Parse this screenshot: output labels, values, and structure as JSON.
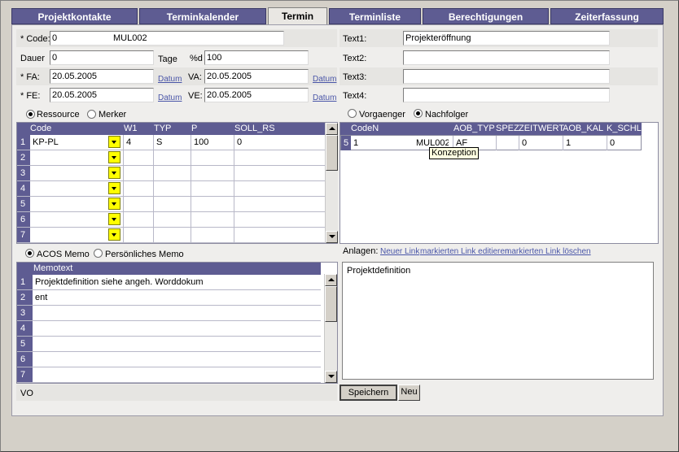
{
  "tabs": [
    {
      "label": "Projektkontakte"
    },
    {
      "label": "Terminkalender"
    },
    {
      "label": "Termin"
    },
    {
      "label": "Terminliste"
    },
    {
      "label": "Berechtigungen"
    },
    {
      "label": "Zeiterfassung"
    }
  ],
  "form": {
    "code_label": "* Code:",
    "code_value": "0",
    "code_id": "MUL002",
    "dauer_label": "Dauer",
    "dauer_value": "0",
    "tage_label": "Tage",
    "pd_label": "%d",
    "pd_value": "100",
    "fa_label": "* FA:",
    "fa_value": "20.05.2005",
    "va_label": "VA:",
    "va_value": "20.05.2005",
    "fe_label": "* FE:",
    "fe_value": "20.05.2005",
    "ve_label": "VE:",
    "ve_value": "20.05.2005",
    "datum_link": "Datum",
    "text1_label": "Text1:",
    "text1_value": "Projekteröffnung",
    "text2_label": "Text2:",
    "text2_value": "",
    "text3_label": "Text3:",
    "text3_value": "",
    "text4_label": "Text4:",
    "text4_value": ""
  },
  "resource_panel": {
    "radio1": "Ressource",
    "radio2": "Merker",
    "headers": [
      "Code",
      "W1",
      "TYP",
      "P",
      "SOLL_RS"
    ],
    "rows": [
      {
        "num": "1",
        "code": "KP-PL",
        "w1": "4",
        "typ": "S",
        "p": "100",
        "soll": "0"
      },
      {
        "num": "2",
        "code": "",
        "w1": "",
        "typ": "",
        "p": "",
        "soll": ""
      },
      {
        "num": "3",
        "code": "",
        "w1": "",
        "typ": "",
        "p": "",
        "soll": ""
      },
      {
        "num": "4",
        "code": "",
        "w1": "",
        "typ": "",
        "p": "",
        "soll": ""
      },
      {
        "num": "5",
        "code": "",
        "w1": "",
        "typ": "",
        "p": "",
        "soll": ""
      },
      {
        "num": "6",
        "code": "",
        "w1": "",
        "typ": "",
        "p": "",
        "soll": ""
      },
      {
        "num": "7",
        "code": "",
        "w1": "",
        "typ": "",
        "p": "",
        "soll": ""
      }
    ]
  },
  "dependency_panel": {
    "radio1": "Vorgaenger",
    "radio2": "Nachfolger",
    "headers": [
      "CodeN",
      "AOB_TYP",
      "SPEZ",
      "ZEITWERT",
      "AOB_KAL",
      "K_SCHL"
    ],
    "rows": [
      {
        "num": "5",
        "coden": "1",
        "coden_id": "MUL002",
        "aob_typ": "AF",
        "spez": "",
        "zeitwert": "0",
        "aob_kal": "1",
        "k_schl": "0"
      }
    ],
    "tooltip": "Konzeption"
  },
  "memo_panel": {
    "radio1": "ACOS Memo",
    "radio2": "Persönliches Memo",
    "header": "Memotext",
    "rows": [
      {
        "num": "1",
        "text": "Projektdefinition siehe angeh. Worddokum"
      },
      {
        "num": "2",
        "text": "ent"
      },
      {
        "num": "3",
        "text": ""
      },
      {
        "num": "4",
        "text": ""
      },
      {
        "num": "5",
        "text": ""
      },
      {
        "num": "6",
        "text": ""
      },
      {
        "num": "7",
        "text": ""
      }
    ]
  },
  "attachments": {
    "label": "Anlagen:",
    "new_link": "Neuer Link",
    "edit_link": "markierten Link editieren",
    "delete_link": "markierten Link löschen",
    "textarea": "Projektdefinition"
  },
  "footer": {
    "status": "VO",
    "save_button": "Speichern",
    "new_button": "Neu"
  },
  "colors": {
    "tab_bg": "#5e5c92",
    "header_bg": "#5e5c92",
    "dropdown": "#ffff00",
    "link": "#4a56a8"
  }
}
